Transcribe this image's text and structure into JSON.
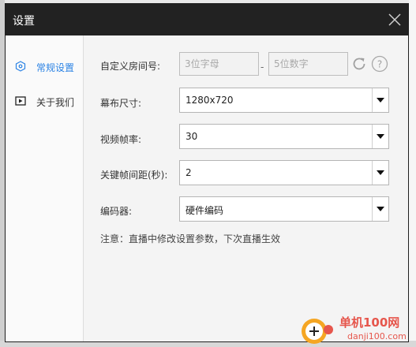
{
  "dialog": {
    "title": "设置"
  },
  "sidebar": {
    "items": [
      {
        "label": "常规设置",
        "icon": "settings-hex-icon",
        "active": true
      },
      {
        "label": "关于我们",
        "icon": "about-play-icon",
        "active": false
      }
    ]
  },
  "form": {
    "room_label": "自定义房间号:",
    "room_letters_placeholder": "3位字母",
    "room_separator": "-",
    "room_digits_placeholder": "5位数字",
    "screen_label": "幕布尺寸:",
    "screen_value": "1280x720",
    "fps_label": "视频帧率:",
    "fps_value": "30",
    "keyframe_label": "关键帧间距(秒):",
    "keyframe_value": "2",
    "encoder_label": "编码器:",
    "encoder_value": "硬件编码",
    "note": "注意：直播中修改设置参数，下次直播生效"
  },
  "watermark": {
    "line1": "单机100网",
    "line2": "danji100.com"
  },
  "colors": {
    "titlebar": "#222222",
    "accent": "#2a82e4",
    "watermark": "#e6564c"
  }
}
